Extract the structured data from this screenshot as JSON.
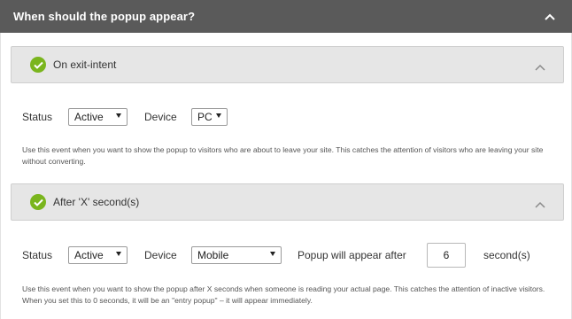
{
  "header": {
    "title": "When should the popup appear?"
  },
  "events": [
    {
      "title": "On exit-intent",
      "status_label": "Status",
      "status_value": "Active",
      "device_label": "Device",
      "device_value": "PC",
      "description": "Use this event when you want to show the popup to visitors who are about to leave your site. This catches the attention of visitors who are leaving your site without converting."
    },
    {
      "title": "After 'X' second(s)",
      "status_label": "Status",
      "status_value": "Active",
      "device_label": "Device",
      "device_value": "Mobile",
      "delay_label": "Popup will appear after",
      "delay_value": "6",
      "delay_unit": "second(s)",
      "description": "Use this event when you want to show the popup after X seconds when someone is reading your actual page. This catches the attention of inactive visitors. When you set this to 0 seconds, it will be an \"entry popup\" – it will appear immediately."
    }
  ],
  "colors": {
    "topbar": "#5a5a5a",
    "check": "#7ab51d",
    "event_header": "#e6e6e6"
  },
  "icons": {
    "collapse": "chevron-up-icon",
    "enabled": "check-circle-icon"
  }
}
